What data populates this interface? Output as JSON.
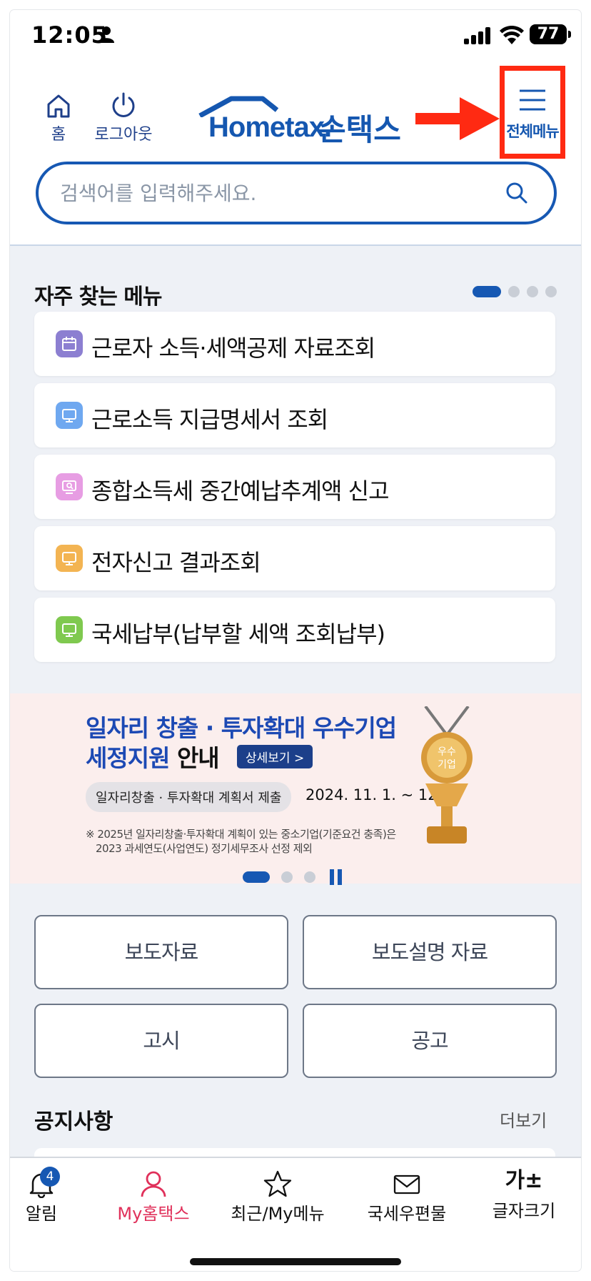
{
  "status_bar": {
    "time": "12:05",
    "battery": "77"
  },
  "header": {
    "home_label": "홈",
    "logout_label": "로그아웃",
    "logo_home": "Hometax.",
    "logo_son": "손택스",
    "menu_label": "전체메뉴"
  },
  "search": {
    "placeholder": "검색어를 입력해주세요."
  },
  "frequent": {
    "title": "자주 찾는 메뉴",
    "items": [
      {
        "label": "근로자 소득·세액공제 자료조회",
        "color": "#8c7fd1",
        "icon": "calendar-icon"
      },
      {
        "label": "근로소득 지급명세서 조회",
        "color": "#6fa8f0",
        "icon": "monitor-icon"
      },
      {
        "label": "종합소득세 중간예납추계액 신고",
        "color": "#e79de3",
        "icon": "monitor-search-icon"
      },
      {
        "label": "전자신고 결과조회",
        "color": "#f3b452",
        "icon": "monitor-icon"
      },
      {
        "label": "국세납부(납부할 세액 조회납부)",
        "color": "#7fc94f",
        "icon": "monitor-icon"
      }
    ]
  },
  "banner": {
    "line1": "일자리 창출 · 투자확대 우수기업",
    "line2_blue": "세정지원",
    "line2_dark": " 안내",
    "detail_button": "상세보기 >",
    "pill": "일자리창출 · 투자확대 계획서 제출",
    "date": "2024. 11. 1. ~ 12. 2.",
    "note1": "※ 2025년 일자리창출·투자확대 계획이 있는 중소기업(기준요건 충족)은",
    "note2": "2023 과세연도(사업연도) 정기세무조사 선정 제외",
    "trophy_text": "우수\n기업"
  },
  "buttons": {
    "press": "보도자료",
    "press_explain": "보도설명 자료",
    "notice_official": "고시",
    "announcement": "공고"
  },
  "notice": {
    "title": "공지사항",
    "more": "더보기"
  },
  "tabbar": {
    "alert": "알림",
    "alert_badge": "4",
    "my": "My홈택스",
    "recent": "최근/My메뉴",
    "post": "국세우편물",
    "font": "글자크기",
    "font_glyph": "가±"
  }
}
